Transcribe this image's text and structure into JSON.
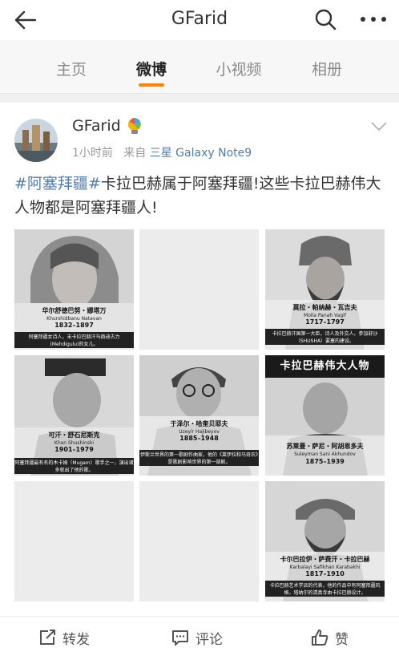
{
  "header": {
    "title": "GFarid",
    "back_icon": "arrow-left-icon",
    "search_icon": "search-icon",
    "more_icon": "more-horizontal-icon"
  },
  "tabs": [
    {
      "label": "主页",
      "active": false
    },
    {
      "label": "微博",
      "active": true
    },
    {
      "label": "小视频",
      "active": false
    },
    {
      "label": "相册",
      "active": false
    }
  ],
  "accent_color": "#ff8200",
  "link_color": "#507daf",
  "post": {
    "username": "GFarid",
    "time": "1小时前",
    "from_label": "来自",
    "source": "三星 Galaxy Note9",
    "hashtag": "#阿塞拜疆#",
    "text": "卡拉巴赫属于阿塞拜疆!这些卡拉巴赫伟大人物都是阿塞拜疆人!"
  },
  "images": [
    {
      "name_cn": "华尔舒德巴努・娜塔万",
      "name_en": "Khurshidbanu Natavan",
      "years": "1832–1897",
      "desc": "阿塞拜疆女诗人，末卡拉巴赫汗马赫迪古力(Mehdigulu)的女儿。"
    },
    {
      "blank": true
    },
    {
      "name_cn": "莫拉・帕纳赫・瓦吉夫",
      "name_en": "Molla Panah Vagif",
      "years": "1717–1797",
      "desc": "卡拉巴赫汗国第一大臣，诗人及外交人。参加舒沙（SHUSHA）要塞的建设。"
    },
    {
      "name_cn": "可汗・舒石尼斯克",
      "name_en": "Khan Shushinski",
      "years": "1901–1979",
      "desc": "阿塞拜疆最有名的木卡姆（Mugam）歌手之一，演出诸多就出了他的歌。"
    },
    {
      "name_cn": "于泽尔・哈奎贝耶夫",
      "name_en": "Uzeyir Hajibeyov",
      "years": "1885–1948",
      "desc": "伊斯兰世界的第一歌剧作曲家，他的《莱伊拉和马奇农》是歌剧影响世界的第一部剧。"
    },
    {
      "poster_title": "卡拉巴赫伟大人物",
      "name_cn": "苏莱曼・萨尼・阿胡恩多夫",
      "name_en": "Suleyman Sani Akhundov",
      "years": "1875–1939"
    },
    {
      "blank": true
    },
    {
      "blank": true
    },
    {
      "name_cn": "卡尔巴拉伊・萨费汗・卡拉巴赫",
      "name_en": "Karbalayi Safikhan Karabakhi",
      "years": "1817–1910",
      "desc": "卡拉巴赫艺术学派的代表，他的作品中有阿塞拜疆风格，塔纳尔的清真寺由卡拉巴赫设计。"
    }
  ],
  "actions": {
    "repost": "转发",
    "comment": "评论",
    "like": "赞"
  }
}
